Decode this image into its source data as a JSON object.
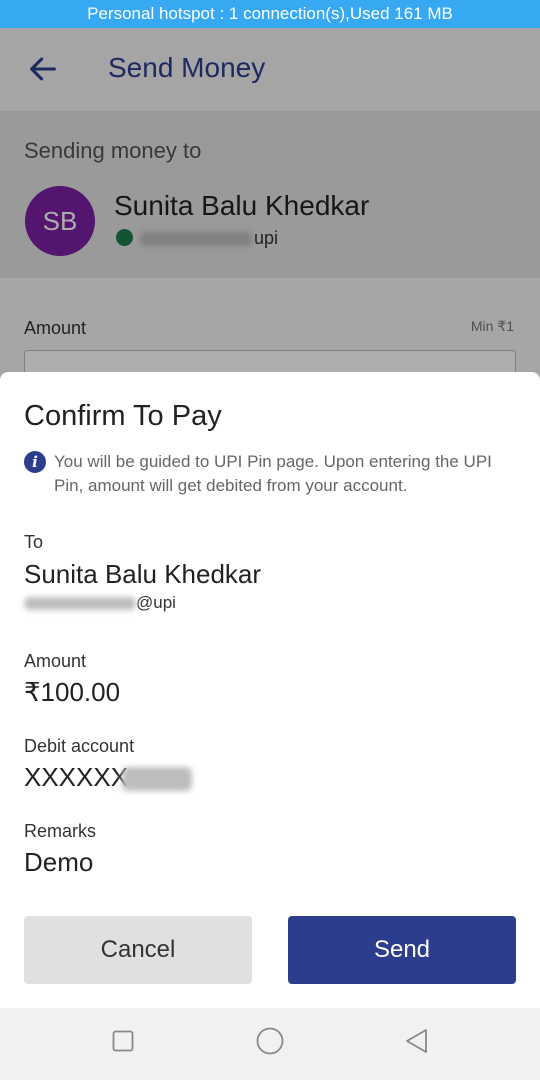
{
  "status_bar": {
    "text": "Personal hotspot : 1 connection(s),Used  161 MB"
  },
  "app_bar": {
    "title": "Send Money",
    "back_icon": "arrow-left-icon"
  },
  "recipient": {
    "heading": "Sending money to",
    "avatar_initials": "SB",
    "avatar_color": "#7b1fa2",
    "name": "Sunita Balu Khedkar",
    "upi_suffix": "upi"
  },
  "amount_field": {
    "label": "Amount",
    "min_label": "Min ₹1"
  },
  "dialog": {
    "title": "Confirm To Pay",
    "info_text": "You will be guided to UPI Pin page. Upon entering the UPI Pin, amount will get debited from your account.",
    "to_label": "To",
    "to_name": "Sunita Balu Khedkar",
    "to_upi_suffix": "@upi",
    "amount_label": "Amount",
    "amount_value": "₹100.00",
    "debit_label": "Debit account",
    "debit_value": "XXXXXX",
    "remarks_label": "Remarks",
    "remarks_value": "Demo",
    "cancel_label": "Cancel",
    "send_label": "Send"
  },
  "colors": {
    "primary": "#2b3d8c",
    "status_bar": "#37a9f2",
    "verified": "#1e7d4f"
  },
  "nav_icons": [
    "square-icon",
    "circle-icon",
    "triangle-back-icon"
  ]
}
